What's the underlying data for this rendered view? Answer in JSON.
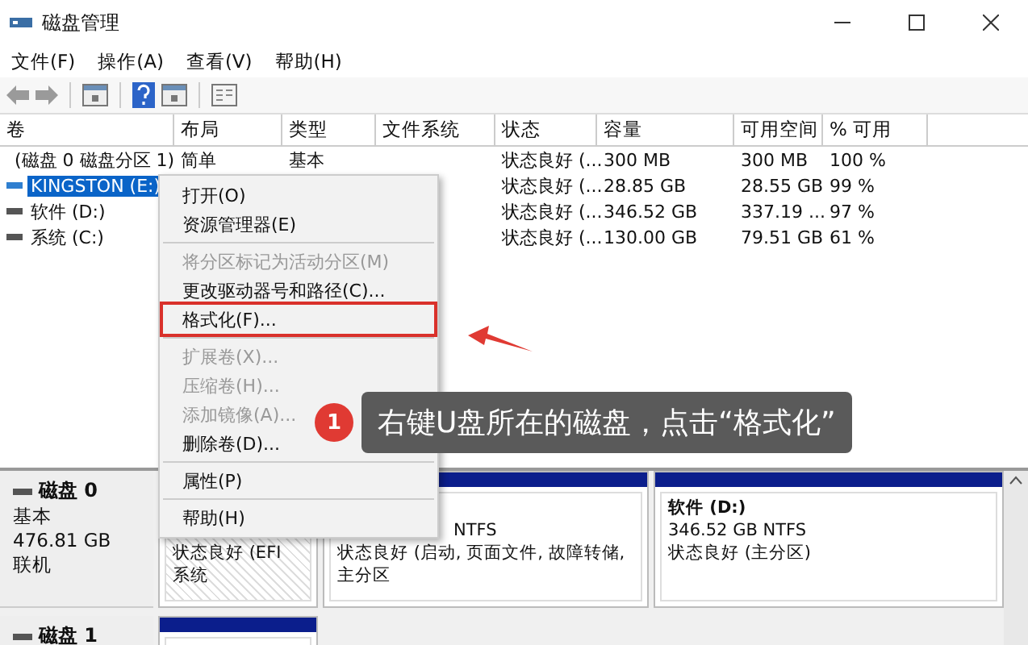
{
  "window": {
    "title": "磁盘管理"
  },
  "menu_bar": [
    "文件(F)",
    "操作(A)",
    "查看(V)",
    "帮助(H)"
  ],
  "table": {
    "columns": [
      "卷",
      "布局",
      "类型",
      "文件系统",
      "状态",
      "容量",
      "可用空间",
      "% 可用"
    ],
    "rows": [
      {
        "selected": false,
        "cells": [
          "(磁盘 0 磁盘分区 1)",
          "简单",
          "基本",
          "",
          "状态良好 (...",
          "300 MB",
          "300 MB",
          "100 %"
        ]
      },
      {
        "selected": true,
        "cells": [
          "KINGSTON (E:)",
          "",
          "",
          "",
          "状态良好 (...",
          "28.85 GB",
          "28.55 GB",
          "99 %"
        ]
      },
      {
        "selected": false,
        "cells": [
          "软件 (D:)",
          "",
          "",
          "",
          "状态良好 (...",
          "346.52 GB",
          "337.19 ...",
          "97 %"
        ]
      },
      {
        "selected": false,
        "cells": [
          "系统 (C:)",
          "",
          "",
          "",
          "状态良好 (...",
          "130.00 GB",
          "79.51 GB",
          "61 %"
        ]
      }
    ]
  },
  "context_menu": [
    {
      "kind": "item",
      "label": "打开(O)",
      "disabled": false,
      "boxed": false
    },
    {
      "kind": "item",
      "label": "资源管理器(E)",
      "disabled": false,
      "boxed": false
    },
    {
      "kind": "separator"
    },
    {
      "kind": "item",
      "label": "将分区标记为活动分区(M)",
      "disabled": true,
      "boxed": false
    },
    {
      "kind": "item",
      "label": "更改驱动器号和路径(C)...",
      "disabled": false,
      "boxed": false
    },
    {
      "kind": "item",
      "label": "格式化(F)...",
      "disabled": false,
      "boxed": true
    },
    {
      "kind": "separator"
    },
    {
      "kind": "item",
      "label": "扩展卷(X)...",
      "disabled": true,
      "boxed": false
    },
    {
      "kind": "item",
      "label": "压缩卷(H)...",
      "disabled": true,
      "boxed": false
    },
    {
      "kind": "item",
      "label": "添加镜像(A)...",
      "disabled": true,
      "boxed": false
    },
    {
      "kind": "item",
      "label": "删除卷(D)...",
      "disabled": false,
      "boxed": false
    },
    {
      "kind": "separator"
    },
    {
      "kind": "item",
      "label": "属性(P)",
      "disabled": false,
      "boxed": false
    },
    {
      "kind": "separator"
    },
    {
      "kind": "item",
      "label": "帮助(H)",
      "disabled": false,
      "boxed": false
    }
  ],
  "callout": {
    "number": "1",
    "text": "右键U盘所在的磁盘，点击“格式化”"
  },
  "disks": [
    {
      "name": "磁盘 0",
      "info": [
        "基本",
        "476.81 GB",
        "联机"
      ],
      "partitions": [
        {
          "hatched": true,
          "lines": [
            {
              "kind": "low",
              "text": "状态良好 (EFI 系统"
            }
          ]
        },
        {
          "hatched": false,
          "lines": [
            {
              "kind": "tail",
              "text": "NTFS"
            },
            {
              "kind": "line",
              "text": "状态良好 (启动, 页面文件, 故障转储, 主分区"
            }
          ]
        },
        {
          "hatched": false,
          "lines": [
            {
              "kind": "bold",
              "text": "软件 (D:)"
            },
            {
              "kind": "line",
              "text": "346.52 GB NTFS"
            },
            {
              "kind": "line",
              "text": "状态良好 (主分区)"
            }
          ]
        }
      ]
    },
    {
      "name": "磁盘 1",
      "partitions": [
        {
          "hatched": false
        }
      ]
    }
  ]
}
